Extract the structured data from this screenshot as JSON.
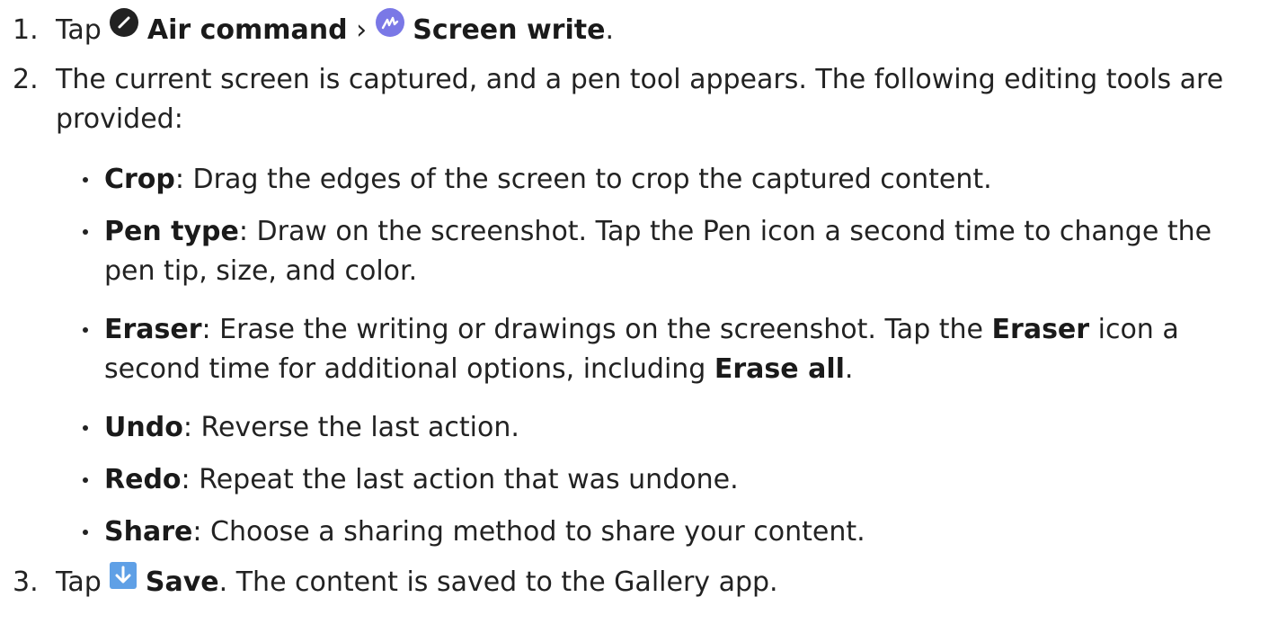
{
  "steps": [
    {
      "number": "1.",
      "tap": "Tap",
      "air_command": "Air command",
      "separator": "›",
      "screen_write": "Screen write",
      "end": "."
    },
    {
      "number": "2.",
      "text": "The current screen is captured, and a pen tool appears. The following editing tools are provided:"
    },
    {
      "number": "3.",
      "tap": "Tap",
      "save": "Save",
      "rest": ". The content is saved to the Gallery app."
    }
  ],
  "tools": [
    {
      "name": "Crop",
      "desc": ": Drag the edges of the screen to crop the captured content."
    },
    {
      "name": "Pen type",
      "desc": ": Draw on the screenshot. Tap the Pen icon a second time to change the pen tip, size, and color."
    },
    {
      "name": "Eraser",
      "desc_a": ": Erase the writing or drawings on the screenshot. Tap the ",
      "eraser_word": "Eraser",
      "desc_b": " icon a second time for additional options, including ",
      "erase_all": "Erase all",
      "desc_c": "."
    },
    {
      "name": "Undo",
      "desc": ": Reverse the last action."
    },
    {
      "name": "Redo",
      "desc": ": Repeat the last action that was undone."
    },
    {
      "name": "Share",
      "desc": ": Choose a sharing method to share your content."
    }
  ],
  "icons": {
    "air_command": "pen-circle-icon",
    "screen_write": "screen-write-icon",
    "save": "download-arrow-icon"
  },
  "colors": {
    "text": "#222222",
    "air_command_icon": "#222222",
    "screen_write_icon": "#7a78e6",
    "save_icon": "#5fa0e6"
  }
}
